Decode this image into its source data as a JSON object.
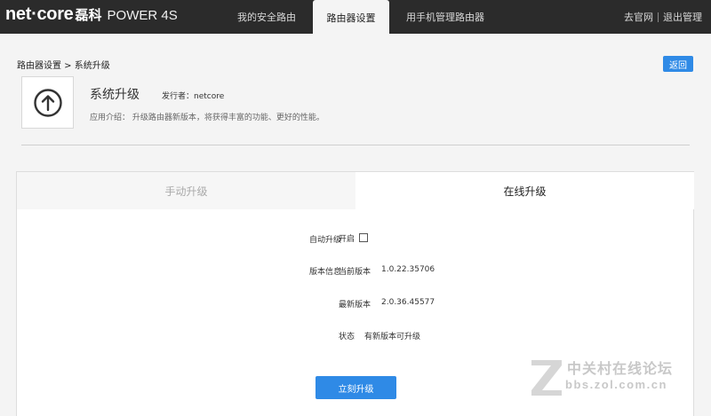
{
  "brand": {
    "logo": "net·core",
    "cn": "磊科",
    "model": "POWER 4S"
  },
  "nav": {
    "items": [
      {
        "label": "我的安全路由"
      },
      {
        "label": "路由器设置",
        "active": true
      },
      {
        "label": "用手机管理路由器"
      }
    ],
    "right": {
      "official_site": "去官网",
      "logout": "退出管理"
    }
  },
  "breadcrumb": "路由器设置 > 系统升级",
  "back_label": "返回",
  "app": {
    "title": "系统升级",
    "publisher": "发行者：netcore",
    "intro": "应用介绍：  升级路由器新版本，将获得丰富的功能、更好的性能。",
    "icon": "upload-arrow-icon"
  },
  "tabs": [
    {
      "label": "手动升级",
      "active": false
    },
    {
      "label": "在线升级",
      "active": true
    }
  ],
  "online": {
    "auto_upgrade_label": "自动升级",
    "auto_upgrade_option": "开启",
    "auto_upgrade_checked": false,
    "version_info_label": "版本信息",
    "current_version_label": "当前版本",
    "current_version": "1.0.22.35706",
    "latest_version_label": "最新版本",
    "latest_version": "2.0.36.45577",
    "status_label": "状态",
    "status": "有新版本可升级",
    "upgrade_button": "立刻升级"
  },
  "watermark": {
    "cn": "中关村在线论坛",
    "url": "bbs.zol.com.cn"
  },
  "colors": {
    "topbar": "#2b2b2b",
    "accent": "#2f8ae6",
    "page_bg": "#f4f4f4"
  }
}
